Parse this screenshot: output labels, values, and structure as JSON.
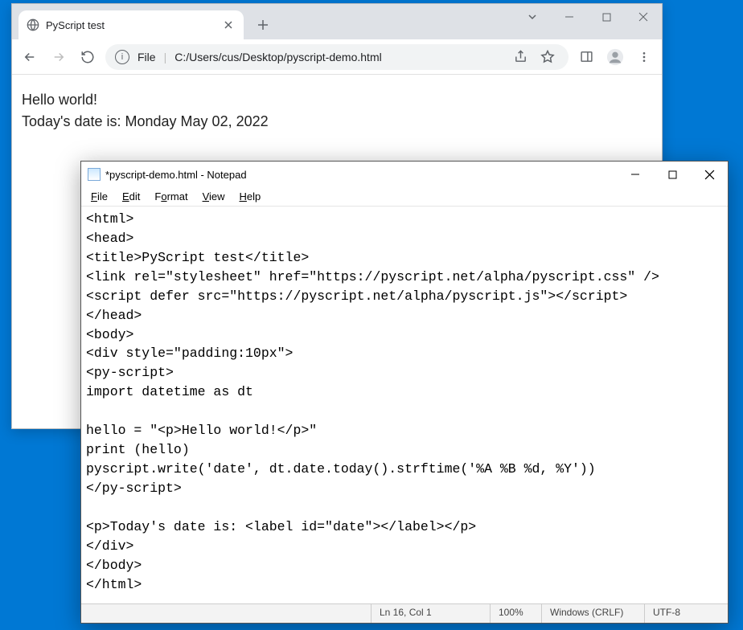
{
  "chrome": {
    "tab_title": "PyScript test",
    "url_label": "File",
    "url_path": "C:/Users/cus/Desktop/pyscript-demo.html"
  },
  "page": {
    "line1": "Hello world!",
    "line2_prefix": "Today's date is: ",
    "date_value": "Monday May 02, 2022"
  },
  "notepad": {
    "title": "*pyscript-demo.html - Notepad",
    "menu": {
      "file": "File",
      "edit": "Edit",
      "format": "Format",
      "view": "View",
      "help": "Help"
    },
    "content": "<html>\n<head>\n<title>PyScript test</title>\n<link rel=\"stylesheet\" href=\"https://pyscript.net/alpha/pyscript.css\" />\n<script defer src=\"https://pyscript.net/alpha/pyscript.js\"></script>\n</head>\n<body>\n<div style=\"padding:10px\">\n<py-script>\nimport datetime as dt\n\nhello = \"<p>Hello world!</p>\"\nprint (hello)\npyscript.write('date', dt.date.today().strftime('%A %B %d, %Y'))\n</py-script>\n\n<p>Today's date is: <label id=\"date\"></label></p>\n</div>\n</body>\n</html>",
    "status": {
      "position": "Ln 16, Col 1",
      "zoom": "100%",
      "eol": "Windows (CRLF)",
      "encoding": "UTF-8"
    }
  }
}
